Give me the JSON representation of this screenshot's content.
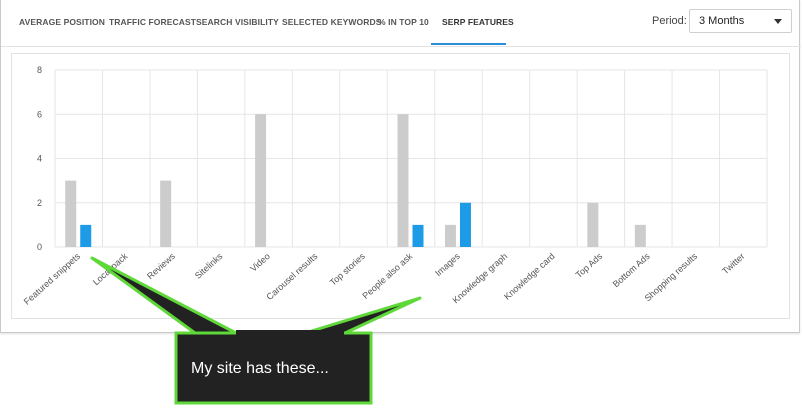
{
  "tabs": [
    {
      "label": "AVERAGE POSITION",
      "active": false
    },
    {
      "label": "TRAFFIC FORECAST",
      "active": false
    },
    {
      "label": "SEARCH VISIBILITY",
      "active": false
    },
    {
      "label": "SELECTED KEYWORDS",
      "active": false
    },
    {
      "label": "% IN TOP 10",
      "active": false
    },
    {
      "label": "SERP FEATURES",
      "active": true
    }
  ],
  "period": {
    "label": "Period:",
    "value": "3 Months"
  },
  "callout": {
    "text": "My site has these..."
  },
  "colors": {
    "series_gray": "#cccccc",
    "series_blue": "#1e9be6",
    "tab_accent": "#2b8ed8",
    "callout_bg": "#222222",
    "callout_border": "#5fd83a"
  },
  "chart_data": {
    "type": "bar",
    "categories": [
      "Featured snippets",
      "Local pack",
      "Reviews",
      "Sitelinks",
      "Video",
      "Carousel results",
      "Top stories",
      "People also ask",
      "Images",
      "Knowledge graph",
      "Knowledge card",
      "Top Ads",
      "Bottom Ads",
      "Shopping results",
      "Twitter"
    ],
    "series": [
      {
        "color": "#cccccc",
        "values": [
          3,
          0,
          3,
          0,
          6,
          0,
          0,
          6,
          1,
          0,
          0,
          2,
          1,
          0,
          0
        ]
      },
      {
        "color": "#1e9be6",
        "values": [
          1,
          0,
          0,
          0,
          0,
          0,
          0,
          1,
          2,
          0,
          0,
          0,
          0,
          0,
          0
        ]
      }
    ],
    "yticks": [
      0,
      2,
      4,
      6,
      8
    ],
    "ylim": [
      0,
      8
    ],
    "grid": true,
    "legend": "none"
  }
}
